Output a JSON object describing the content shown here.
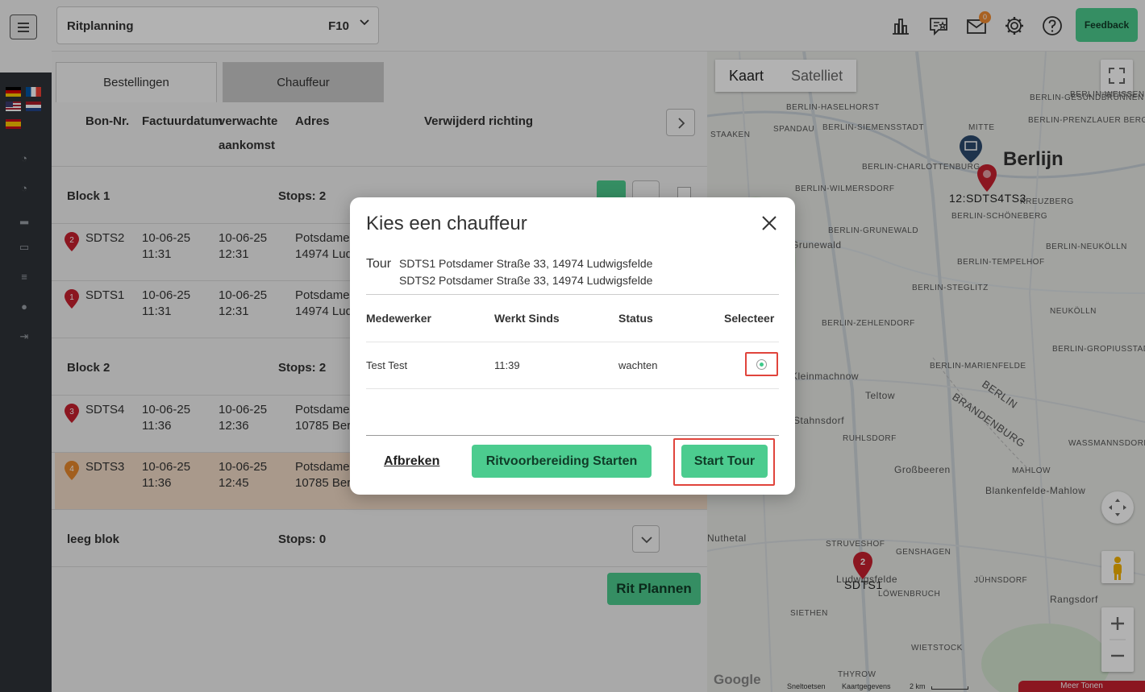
{
  "topbar": {
    "ritplanning_label": "Ritplanning",
    "ritplanning_value": "F10",
    "mail_badge": "0",
    "feedback_label": "Feedback"
  },
  "tabs": [
    {
      "label": "Bestellingen",
      "active": false
    },
    {
      "label": "Chauffeur",
      "active": true
    }
  ],
  "table_headers": {
    "bon_nr": "Bon-Nr.",
    "factuurdatum": "Factuurdatum",
    "verwachte": "verwachte",
    "aankomst": "aankomst",
    "adres": "Adres",
    "verwijderd": "Verwijderd richting"
  },
  "blocks": [
    {
      "title": "Block 1",
      "stops": "Stops: 2",
      "rows": [
        {
          "pin": "2",
          "bon": "SDTS2",
          "fact_date": "10-06-25",
          "fact_time": "11:31",
          "arr_date": "10-06-25",
          "arr_time": "12:31",
          "addr1": "Potsdamer",
          "addr2": "14974 Lud"
        },
        {
          "pin": "1",
          "bon": "SDTS1",
          "fact_date": "10-06-25",
          "fact_time": "11:31",
          "arr_date": "10-06-25",
          "arr_time": "12:31",
          "addr1": "Potsdamer",
          "addr2": "14974 Lud"
        }
      ]
    },
    {
      "title": "Block 2",
      "stops": "Stops: 2",
      "rows": [
        {
          "pin": "3",
          "bon": "SDTS4",
          "fact_date": "10-06-25",
          "fact_time": "11:36",
          "arr_date": "10-06-25",
          "arr_time": "12:36",
          "addr1": "Potsdamer",
          "addr2": "10785 Berl"
        },
        {
          "pin": "4",
          "bon": "SDTS3",
          "fact_date": "10-06-25",
          "fact_time": "11:36",
          "arr_date": "10-06-25",
          "arr_time": "12:45",
          "addr1": "Potsdamer",
          "addr2": "10785 Berl"
        }
      ]
    },
    {
      "title": "leeg blok",
      "stops": "Stops: 0",
      "rows": []
    }
  ],
  "rit_plannen_label": "Rit Plannen",
  "map": {
    "type_kaart": "Kaart",
    "type_satelliet": "Satelliet",
    "city_label": "Berlijn",
    "marker_labels": [
      "12:SDTS4TS3",
      "SDTS1"
    ],
    "places": [
      "BERLIN-HASELHORST",
      "BERLIN-GESUNDBRUNNEN",
      "BERLIN-WEISSENSE",
      "SPANDAU",
      "BERLIN-SIEMENSSTADT",
      "MITTE",
      "BERLIN-PRENZLAUER BERG",
      "BERLIN-CHARLOTTENBURG",
      "BERLIN-WILMERSDORF",
      "KREUZBERG",
      "BERLIN-SCHÖNEBERG",
      "BERLIN-GRUNEWALD",
      "BERLIN-NEUKÖLLN",
      "BERLIN-TEMPELHOF",
      "BERLIN-STEGLITZ",
      "NEUKÖLLN",
      "BERLIN-ZEHLENDORF",
      "BERLIN-GROPIUSSTAD",
      "BERLIN-MARIENFELDE",
      "Teltow",
      "BERLIN",
      "BRANDENBURG",
      "RUHLSDORF",
      "WASSMANNSDORF",
      "Großbeeren",
      "MAHLOW",
      "Blankenfelde-Mahlow",
      "STRUVESHOF",
      "GENSHAGEN",
      "JÜHNSDORF",
      "LÖWENBRUCH",
      "Rangsdorf",
      "SIETHEN",
      "WIETSTOCK",
      "THYROW",
      "Grunewald",
      "Kleinmachnow",
      "Stahnsdorf",
      "Nuthetal",
      "STAAKEN",
      "Ludwigsfelde"
    ],
    "footer": [
      "Sneltoetsen",
      "Kaartgegevens",
      "2 km",
      "Meer Tonen"
    ]
  },
  "modal": {
    "title": "Kies een chauffeur",
    "tour_label": "Tour",
    "tour_lines": [
      "SDTS1  Potsdamer Straße 33, 14974 Ludwigsfelde",
      "SDTS2  Potsdamer Straße 33, 14974 Ludwigsfelde"
    ],
    "headers": {
      "medewerker": "Medewerker",
      "werkt_sinds": "Werkt Sinds",
      "status": "Status",
      "selecteer": "Selecteer"
    },
    "rows": [
      {
        "name": "Test Test",
        "since": "11:39",
        "status": "wachten",
        "selected": true
      }
    ],
    "afbreken": "Afbreken",
    "ritvoorbereiding": "Ritvoorbereiding Starten",
    "start_tour": "Start Tour"
  },
  "colors": {
    "accent": "#4ccc8f",
    "highlight": "#e0443c",
    "sidebar": "#2f3338",
    "row_highlight": "#f2dcc8"
  }
}
